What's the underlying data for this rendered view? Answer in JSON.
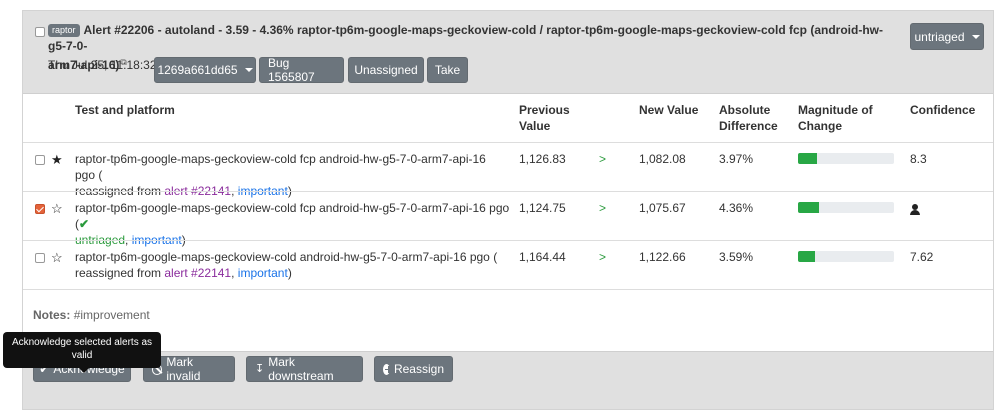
{
  "alert": {
    "tag": "raptor",
    "title_line1": "Alert #22206 - autoland - 3.59 - 4.36% raptor-tp6m-google-maps-geckoview-cold / raptor-tp6m-google-maps-geckoview-cold fcp (android-hw-g5-7-0-",
    "title_line2": "arm7-api-16)",
    "date": "Thu Jul 25, 11:18:32",
    "revision_label": "1269a661dd65",
    "bug_label": "Bug 1565807",
    "assignee_label": "Unassigned",
    "take_label": "Take",
    "status_label": "untriaged"
  },
  "columns": {
    "test": "Test and platform",
    "previous": "Previous Value",
    "new_value": "New Value",
    "absolute": "Absolute Difference",
    "magnitude": "Magnitude of Change",
    "confidence": "Confidence"
  },
  "rows": [
    {
      "starred": true,
      "checked": false,
      "test_line1": "raptor-tp6m-google-maps-geckoview-cold fcp android-hw-g5-7-0-arm7-api-16 pgo (",
      "reassigned_prefix": "reassigned from ",
      "alert_link": "alert #22141",
      "comma": ", ",
      "important": "important",
      "close": ")",
      "previous": "1,126.83",
      "arrow": ">",
      "new_value": "1,082.08",
      "absolute": "3.97%",
      "magnitude": 0.2,
      "confidence": "8.3"
    },
    {
      "starred": false,
      "checked": true,
      "test_line1": "raptor-tp6m-google-maps-geckoview-cold fcp android-hw-g5-7-0-arm7-api-16 pgo (",
      "untriaged": "untriaged",
      "comma": ", ",
      "important": "important",
      "close": ")",
      "previous": "1,124.75",
      "arrow": ">",
      "new_value": "1,075.67",
      "absolute": "4.36%",
      "magnitude": 0.22,
      "confidence_icon": "person-icon"
    },
    {
      "starred": false,
      "checked": false,
      "test_line1": "raptor-tp6m-google-maps-geckoview-cold android-hw-g5-7-0-arm7-api-16 pgo (",
      "reassigned_prefix": "reassigned from ",
      "alert_link": "alert #22141",
      "comma": ", ",
      "important": "important",
      "close": ")",
      "previous": "1,164.44",
      "arrow": ">",
      "new_value": "1,122.66",
      "absolute": "3.59%",
      "magnitude": 0.18,
      "confidence": "7.62"
    }
  ],
  "notes": {
    "label": "Notes:",
    "text": "#improvement"
  },
  "footer": {
    "tooltip": "Acknowledge selected alerts as valid",
    "acknowledge": "Acknowledge",
    "mark_invalid": "Mark invalid",
    "mark_downstream": "Mark downstream",
    "reassign": "Reassign"
  },
  "colors": {
    "header_bg": "#e0e0e0",
    "button_bg": "#6c757d",
    "magnitude_fill": "#28a745",
    "link_purple": "#8a2b9c",
    "link_blue": "#1a73e8",
    "arrow_green": "#2a9a3c",
    "checkbox_checked": "#e4633a"
  }
}
